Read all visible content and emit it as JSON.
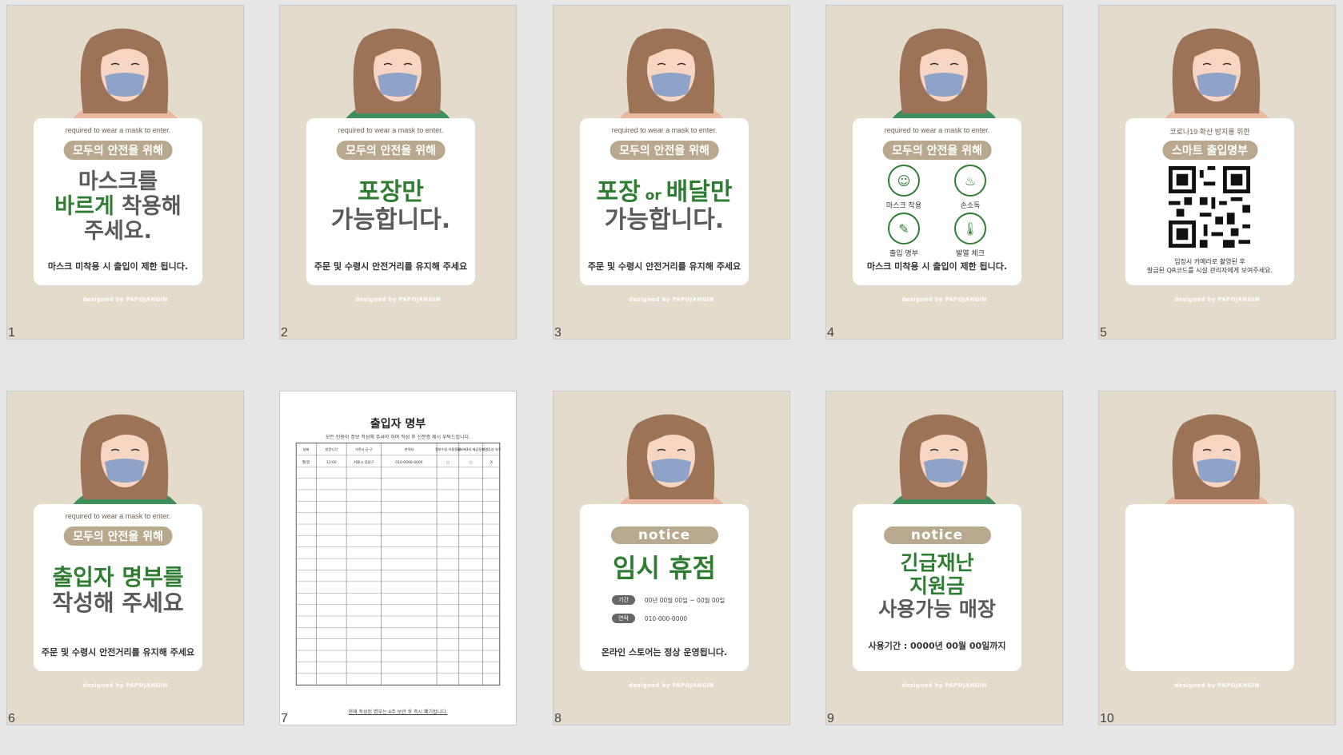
{
  "designed_by": "designed by PAPOJANGIN",
  "slides": [
    {
      "number": "1",
      "shirt": "#e8b8a0",
      "tagline": "required to wear a mask to enter.",
      "pill": "모두의 안전을 위해",
      "line1": "마스크를",
      "line2_green": "바르게",
      "line2_gray": " 착용해",
      "line3": "주세요.",
      "bottom": "마스크 미착용 시 출입이 제한 됩니다."
    },
    {
      "number": "2",
      "shirt": "#3f8f5c",
      "tagline": "required to wear a mask to enter.",
      "pill": "모두의 안전을 위해",
      "line1": "포장만",
      "line2": "가능합니다.",
      "bottom": "주문 및 수령시 안전거리를 유지해 주세요"
    },
    {
      "number": "3",
      "shirt": "#e8b8a0",
      "tagline": "required to wear a mask to enter.",
      "pill": "모두의 안전을 위해",
      "line1a": "포장",
      "line1or": " or ",
      "line1b": "배달만",
      "line2": "가능합니다.",
      "bottom": "주문 및 수령시 안전거리를 유지해 주세요"
    },
    {
      "number": "4",
      "shirt": "#3f8f5c",
      "tagline": "required to wear a mask to enter.",
      "pill": "모두의 안전을 위해",
      "icons": [
        {
          "label": "마스크 착용",
          "glyph": "☺"
        },
        {
          "label": "손소독",
          "glyph": "♨"
        },
        {
          "label": "출입 명부",
          "glyph": "✎"
        },
        {
          "label": "발열 체크",
          "glyph": "🌡"
        }
      ],
      "bottom": "마스크 미착용 시 출입이 제한 됩니다."
    },
    {
      "number": "5",
      "shirt": "#e8b8a0",
      "tagline": "코로나19 확산 방지를 위한",
      "pill": "스마트 출입명부",
      "note1": "입장시 카메라로 촬영된 후",
      "note2": "발급된 QR코드를 시설 관리자에게 보여주세요."
    },
    {
      "number": "6",
      "shirt": "#3f8f5c",
      "tagline": "required to wear a mask to enter.",
      "pill": "모두의 안전을 위해",
      "line1": "출입자 명부를",
      "line2": "작성해 주세요",
      "bottom": "주문 및 수령시 안전거리를 유지해 주세요"
    },
    {
      "number": "7",
      "title": "출입자 명부",
      "subtitle": "모든 인원이 정보 작성해 주셔야 하며 작성 후 신분증 제시 부탁드립니다.",
      "headers": [
        "날짜",
        "방문시각",
        "거주시·군·구",
        "연락처",
        "정보수집 이용동의",
        "정보제3자 제공동의",
        "발열증상 유무"
      ],
      "example": [
        "월/일",
        "13:00",
        "서울시 강남구",
        "010-0000-0000",
        "○",
        "○",
        "X"
      ],
      "footer": "현재 작성된 명부는 4주 보관 후 즉시 폐기됩니다."
    },
    {
      "number": "8",
      "shirt": "#e8b8a0",
      "pill": "notice",
      "line1": "임시 휴점",
      "rows": [
        {
          "k": "기간",
          "v": "00년 00월 00일 ~ 00월 00일"
        },
        {
          "k": "연락",
          "v": "010-000-0000"
        }
      ],
      "bottom": "온라인 스토어는 정상 운영됩니다."
    },
    {
      "number": "9",
      "shirt": "#3f8f5c",
      "pill": "notice",
      "line1": "긴급재난",
      "line2": "지원금",
      "line3": "사용가능 매장",
      "bottom": "사용기간 : 0000년 00월 00일까지"
    },
    {
      "number": "10",
      "shirt": "#e8b8a0"
    }
  ]
}
